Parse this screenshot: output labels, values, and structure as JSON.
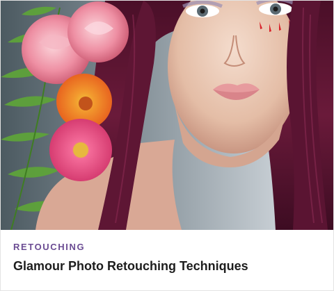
{
  "card": {
    "category": "RETOUCHING",
    "title": "Glamour Photo Retouching Techniques",
    "thumbnail_subject": "portrait-photo"
  },
  "colors": {
    "category_text": "#6b4c93",
    "title_text": "#1d1d1d",
    "hair": "#5a1432",
    "background_left": "#4e5c63",
    "background_right": "#dde3ea"
  }
}
